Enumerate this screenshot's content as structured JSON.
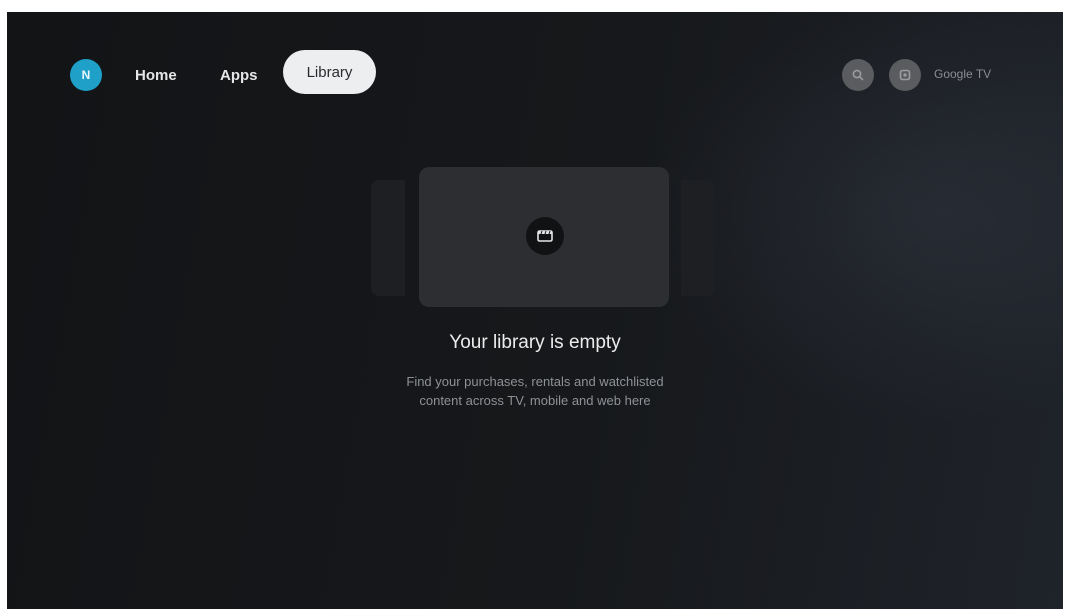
{
  "profile": {
    "initial": "N",
    "color": "#1ea0c9"
  },
  "nav": {
    "tabs": [
      {
        "label": "Home",
        "selected": false
      },
      {
        "label": "Apps",
        "selected": false
      },
      {
        "label": "Library",
        "selected": true
      }
    ]
  },
  "top_actions": {
    "search_icon": "search-icon",
    "settings_icon": "settings-icon",
    "brand": "Google TV"
  },
  "empty_state": {
    "icon": "movie-clapper-icon",
    "title": "Your library is empty",
    "description_line1": "Find your purchases, rentals and watchlisted",
    "description_line2": "content across TV, mobile and web here"
  }
}
